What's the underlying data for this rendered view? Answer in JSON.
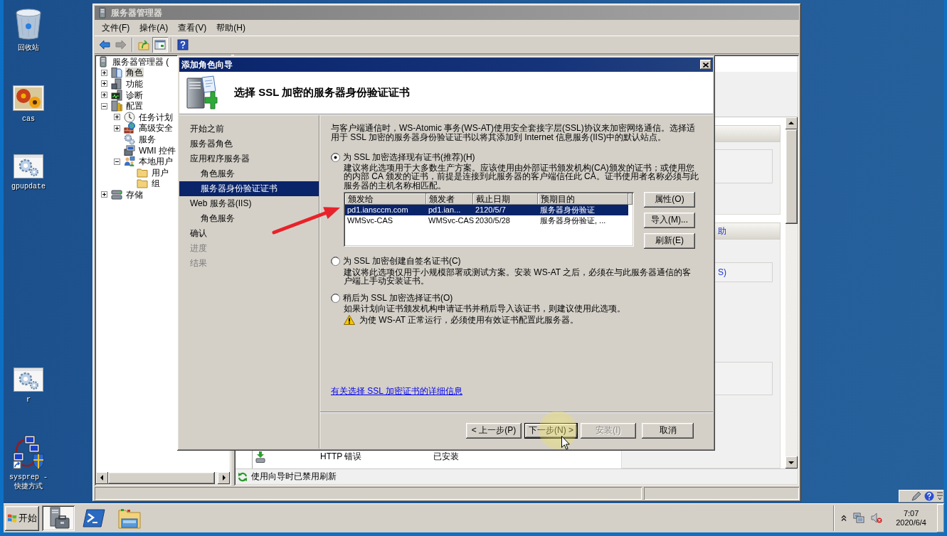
{
  "desktop_icons": [
    {
      "label": "回收站",
      "kind": "recycle-bin"
    },
    {
      "label": "cas",
      "kind": "image"
    },
    {
      "label": "gpupdate",
      "kind": "script"
    },
    {
      "label": "r",
      "kind": "script"
    },
    {
      "label": "sysprep - 快捷方式",
      "kind": "shortcut"
    }
  ],
  "server_manager": {
    "title": "服务器管理器",
    "active": false,
    "menu": [
      "文件(F)",
      "操作(A)",
      "查看(V)",
      "帮助(H)"
    ],
    "toolbar": [
      [
        {
          "kind": "back",
          "disabled": false,
          "pressed": false
        },
        {
          "kind": "forward",
          "disabled": true,
          "pressed": false
        }
      ],
      [
        {
          "kind": "up",
          "disabled": false,
          "pressed": false
        },
        {
          "kind": "console-tree",
          "disabled": false,
          "pressed": true
        }
      ],
      [
        {
          "kind": "help",
          "disabled": false,
          "pressed": false
        }
      ]
    ],
    "tree": {
      "label": "服务器管理器 (",
      "kind": "server",
      "selected": false,
      "children": [
        {
          "label": "角色",
          "kind": "roles",
          "selected": true,
          "expanded": false
        },
        {
          "label": "功能",
          "kind": "features",
          "selected": false,
          "expanded": false
        },
        {
          "label": "诊断",
          "kind": "diagnostics",
          "selected": false,
          "expanded": false
        },
        {
          "label": "配置",
          "kind": "configuration",
          "selected": false,
          "expanded": true,
          "children": [
            {
              "label": "任务计划",
              "kind": "scheduler",
              "selected": false,
              "expanded": false
            },
            {
              "label": "高级安全",
              "kind": "firewall",
              "selected": false,
              "expanded": false
            },
            {
              "label": "服务",
              "kind": "services",
              "selected": false
            },
            {
              "label": "WMI 控件",
              "kind": "wmi",
              "selected": false
            },
            {
              "label": "本地用户",
              "kind": "users",
              "selected": false,
              "expanded": true,
              "children": [
                {
                  "label": "用户",
                  "kind": "folder",
                  "selected": false
                },
                {
                  "label": "组",
                  "kind": "folder",
                  "selected": false
                }
              ]
            }
          ]
        },
        {
          "label": "存储",
          "kind": "storage",
          "selected": false,
          "expanded": false
        }
      ]
    },
    "task_pane": {
      "section_title": "助",
      "link": "S)"
    },
    "role_services": [
      {
        "name": "HTTP 错误",
        "status": "已安装"
      }
    ],
    "notice": "使用向导时已禁用刷新"
  },
  "wizard": {
    "title": "添加角色向导",
    "active": true,
    "heading": "选择 SSL 加密的服务器身份验证证书",
    "steps": [
      {
        "label": "开始之前",
        "selected": false,
        "disabled": false
      },
      {
        "label": "服务器角色",
        "selected": false,
        "disabled": false
      },
      {
        "label": "应用程序服务器",
        "selected": false,
        "disabled": false,
        "children": [
          {
            "label": "角色服务",
            "selected": false,
            "disabled": false
          },
          {
            "label": "服务器身份验证证书",
            "selected": true,
            "disabled": false
          }
        ]
      },
      {
        "label": "Web 服务器(IIS)",
        "selected": false,
        "disabled": false,
        "children": [
          {
            "label": "角色服务",
            "selected": false,
            "disabled": false
          }
        ]
      },
      {
        "label": "确认",
        "selected": false,
        "disabled": false
      },
      {
        "label": "进度",
        "selected": false,
        "disabled": true
      },
      {
        "label": "结果",
        "selected": false,
        "disabled": true
      }
    ],
    "intro": "与客户端通信时，WS-Atomic 事务(WS-AT)使用安全套接字层(SSL)协议来加密网络通信。选择适用于 SSL 加密的服务器身份验证证书以将其添加到 Internet 信息服务(IIS)中的默认站点。",
    "options": [
      {
        "label": "为 SSL 加密选择现有证书(推荐)(H)",
        "selected": true,
        "description": "建议将此选项用于大多数生产方案。应该使用由外部证书颁发机构(CA)颁发的证书；或使用您的内部 CA 颁发的证书，前提是连接到此服务器的客户端信任此 CA。证书使用者名称必须与此服务器的主机名称相匹配。",
        "certificates": {
          "columns": [
            "颁发给",
            "颁发者",
            "截止日期",
            "预期目的"
          ],
          "rows": [
            {
              "cells": [
                "pd1.iansccm.com",
                "pd1.ian...",
                "2120/5/7",
                "服务器身份验证"
              ],
              "selected": true
            },
            {
              "cells": [
                "WMSvc-CAS",
                "WMSvc-CAS",
                "2030/5/28",
                "服务器身份验证, ..."
              ],
              "selected": false
            }
          ],
          "buttons": [
            "属性(O)",
            "导入(M)...",
            "刷新(E)"
          ]
        }
      },
      {
        "label": "为 SSL 加密创建自签名证书(C)",
        "selected": false,
        "description": "建议将此选项仅用于小规模部署或测试方案。安装 WS-AT 之后，必须在与此服务器通信的客户端上手动安装证书。"
      },
      {
        "label": "稍后为 SSL 加密选择证书(O)",
        "selected": false,
        "description": "如果计划向证书颁发机构申请证书并稍后导入该证书，则建议使用此选项。",
        "warning": "为使 WS-AT 正常运行，必须使用有效证书配置此服务器。"
      }
    ],
    "link": "有关选择 SSL 加密证书的详细信息",
    "buttons": [
      {
        "label": "< 上一步(P)",
        "disabled": false,
        "focused": false
      },
      {
        "label": "下一步(N) >",
        "disabled": false,
        "focused": true
      },
      {
        "label": "安装(I)",
        "disabled": true,
        "focused": false
      },
      {
        "label": "取消",
        "disabled": false,
        "focused": false
      }
    ]
  },
  "taskbar": {
    "start": "开始",
    "apps": [
      {
        "kind": "server-manager",
        "active": true
      },
      {
        "kind": "powershell",
        "active": false
      },
      {
        "kind": "explorer",
        "active": false
      }
    ],
    "clock": {
      "time": "7:07",
      "date": "2020/6/4"
    }
  }
}
